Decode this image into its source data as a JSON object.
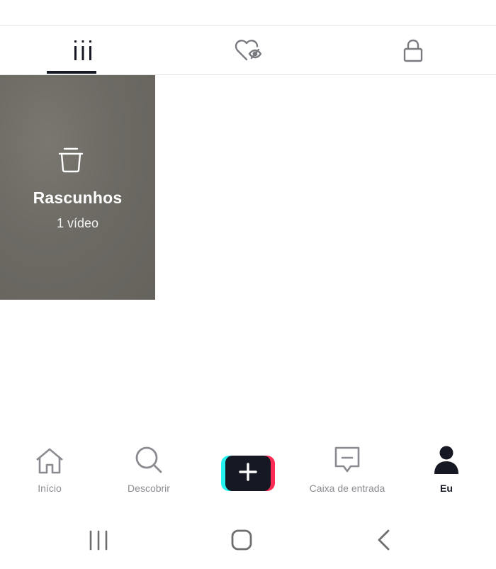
{
  "tabs": [
    {
      "icon": "grid-icon",
      "active": true
    },
    {
      "icon": "liked-hidden-heart-icon",
      "active": false
    },
    {
      "icon": "lock-icon",
      "active": false
    }
  ],
  "drafts": {
    "icon": "trash-icon",
    "title": "Rascunhos",
    "count": "1 vídeo"
  },
  "bottom_nav": {
    "home": {
      "label": "Início",
      "icon": "home-icon"
    },
    "discover": {
      "label": "Descobrir",
      "icon": "search-icon"
    },
    "create": {
      "icon": "plus-icon"
    },
    "inbox": {
      "label": "Caixa de entrada",
      "icon": "inbox-icon"
    },
    "me": {
      "label": "Eu",
      "icon": "profile-icon",
      "active": true
    }
  },
  "system_nav": {
    "recents": "recents-icon",
    "home": "home-circle-icon",
    "back": "back-icon"
  },
  "colors": {
    "text_primary": "#161823",
    "text_secondary": "#8a8b91",
    "accent_cyan": "#25f4ee",
    "accent_red": "#fe2c55",
    "tile_bg": "#6f6c66"
  }
}
